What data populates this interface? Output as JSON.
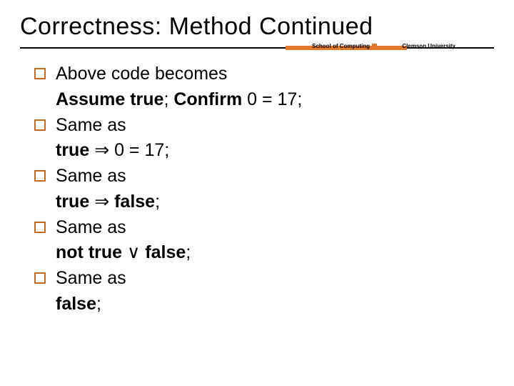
{
  "title": "Correctness: Method Continued",
  "header": {
    "left": "School of Computing",
    "right": "Clemson University"
  },
  "items": [
    {
      "lead": "Above code becomes",
      "sub_html": "<b>Assume true</b>; <b>Confirm</b> 0 = 17;"
    },
    {
      "lead": "Same as",
      "sub_html": "<b>true</b> <span class='sym'>⇒</span> 0 = 17;"
    },
    {
      "lead": "Same as",
      "sub_html": "<b>true</b> <span class='sym'>⇒</span> <b>false</b>;"
    },
    {
      "lead": "Same as",
      "sub_html": "<b>not true</b> <span class='sym'>∨</span> <b>false</b>;"
    },
    {
      "lead": "Same as",
      "sub_html": "<b>false</b>;"
    }
  ]
}
